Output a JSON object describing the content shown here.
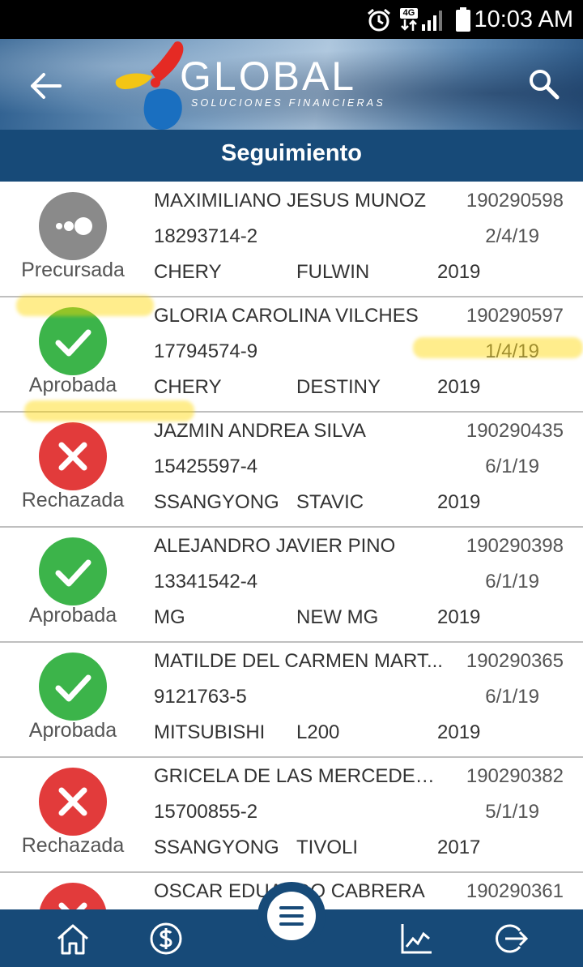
{
  "status_bar": {
    "time": "10:03 AM",
    "network": "4G"
  },
  "header": {
    "brand": "GLOBAL",
    "tagline": "SOLUCIONES FINANCIERAS"
  },
  "page_title": "Seguimiento",
  "colors": {
    "primary": "#174a78",
    "approved": "#3cb44a",
    "rejected": "#e23b3b",
    "pending": "#8a8a8a"
  },
  "rows": [
    {
      "status": "pending",
      "status_label": "Precursada",
      "name": "MAXIMILIANO JESUS MUNOZ",
      "number": "190290598",
      "rut": "18293714-2",
      "date": "2/4/19",
      "brand": "CHERY",
      "model": "FULWIN",
      "year": "2019"
    },
    {
      "status": "approved",
      "status_label": "Aprobada",
      "name": "GLORIA CAROLINA VILCHES",
      "number": "190290597",
      "rut": "17794574-9",
      "date": "1/4/19",
      "brand": "CHERY",
      "model": "DESTINY",
      "year": "2019"
    },
    {
      "status": "rejected",
      "status_label": "Rechazada",
      "name": "JAZMIN ANDREA SILVA",
      "number": "190290435",
      "rut": "15425597-4",
      "date": "6/1/19",
      "brand": "SSANGYONG",
      "model": "STAVIC",
      "year": "2019"
    },
    {
      "status": "approved",
      "status_label": "Aprobada",
      "name": "ALEJANDRO JAVIER PINO",
      "number": "190290398",
      "rut": "13341542-4",
      "date": "6/1/19",
      "brand": "MG",
      "model": "NEW MG",
      "year": "2019"
    },
    {
      "status": "approved",
      "status_label": "Aprobada",
      "name": "MATILDE DEL CARMEN MART...",
      "number": "190290365",
      "rut": "9121763-5",
      "date": "6/1/19",
      "brand": "MITSUBISHI",
      "model": "L200",
      "year": "2019"
    },
    {
      "status": "rejected",
      "status_label": "Rechazada",
      "name": "GRICELA DE LAS MERCEDES ...",
      "number": "190290382",
      "rut": "15700855-2",
      "date": "5/1/19",
      "brand": "SSANGYONG",
      "model": "TIVOLI",
      "year": "2017"
    },
    {
      "status": "rejected",
      "status_label": "",
      "name": "OSCAR EDUARDO CABRERA",
      "number": "190290361",
      "rut": "",
      "date": "",
      "brand": "",
      "model": "",
      "year": ""
    }
  ],
  "icons": {
    "back": "back-arrow-icon",
    "search": "search-icon",
    "home": "home-icon",
    "money": "dollar-icon",
    "menu": "menu-icon",
    "stats": "chart-icon",
    "logout": "logout-icon"
  }
}
